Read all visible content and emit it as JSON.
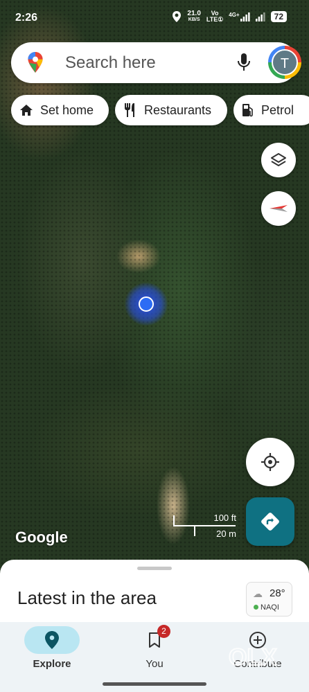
{
  "status_bar": {
    "time": "2:26",
    "speed_value": "21.0",
    "speed_unit": "KB/S",
    "net_top": "Vo",
    "net_bottom": "LTE①",
    "net_4g": "4G+",
    "battery": "72",
    "icons": [
      "location-icon",
      "signal-icon",
      "signal-icon",
      "battery-icon"
    ]
  },
  "search": {
    "placeholder": "Search here",
    "avatar_letter": "T",
    "icons": [
      "google-maps-pin-icon",
      "mic-icon"
    ]
  },
  "chips": [
    {
      "label": "Set home",
      "icon": "home-icon"
    },
    {
      "label": "Restaurants",
      "icon": "fork-knife-icon"
    },
    {
      "label": "Petrol",
      "icon": "fuel-icon"
    }
  ],
  "map": {
    "attribution": "Google",
    "scale_imperial": "100 ft",
    "scale_metric": "20 m",
    "buttons": [
      "layers-icon",
      "compass-icon",
      "my-location-icon",
      "directions-icon"
    ]
  },
  "sheet": {
    "title": "Latest in the area",
    "weather_temp": "28°",
    "air_quality": "NAQI"
  },
  "nav": {
    "items": [
      {
        "label": "Explore",
        "icon": "explore-pin-icon",
        "active": true
      },
      {
        "label": "You",
        "icon": "bookmark-icon",
        "badge": "2"
      },
      {
        "label": "Contribute",
        "icon": "add-circle-icon"
      }
    ]
  },
  "watermark": "OLX",
  "colors": {
    "accent_teal": "#0f7182",
    "active_pill": "#b9e6f2",
    "badge_red": "#c62828",
    "location_blue": "#2c6cf4"
  }
}
